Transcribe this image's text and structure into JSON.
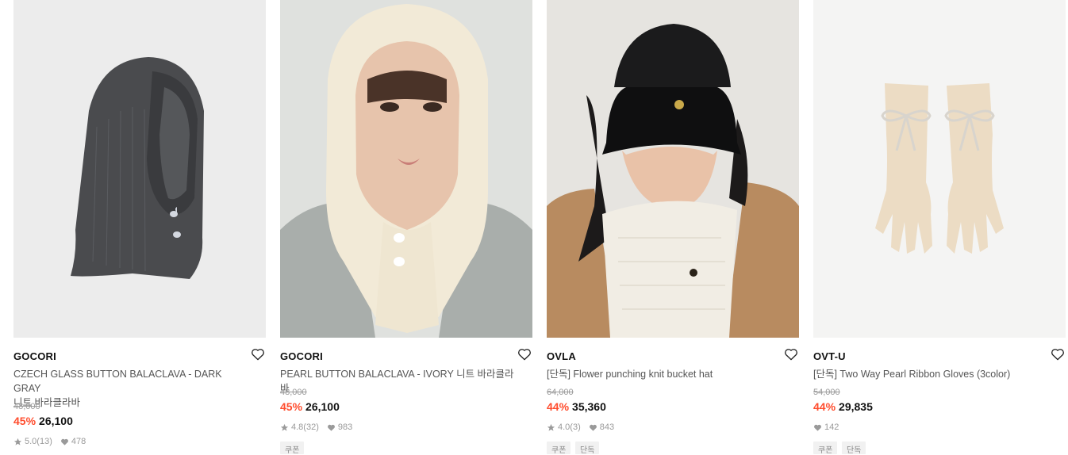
{
  "colors": {
    "discount": "#ff4d2e",
    "muted": "#9a9a9a",
    "badge_bg": "#f1f1f1"
  },
  "products": [
    {
      "brand": "GOCORI",
      "title_line1": "CZECH GLASS BUTTON BALACLAVA - DARK GRAY",
      "title_line2": "니트 바라클라바",
      "original_price": "48,000",
      "discount": "45%",
      "price": "26,100",
      "rating": "5.0",
      "reviews": "(13)",
      "likes": "478",
      "badges": [],
      "image_icon": "dark-gray-balaclava-photo",
      "bg_color": "#ececec"
    },
    {
      "brand": "GOCORI",
      "title_line1": "PEARL BUTTON BALACLAVA - IVORY 니트 바라클라바",
      "original_price": "48,000",
      "discount": "45%",
      "price": "26,100",
      "rating": "4.8",
      "reviews": "(32)",
      "likes": "983",
      "badges": [
        "쿠폰"
      ],
      "image_icon": "ivory-balaclava-model-photo",
      "bg_color": "#dfe1de"
    },
    {
      "brand": "OVLA",
      "title_line1": "[단독] Flower punching knit bucket hat",
      "original_price": "64,000",
      "discount": "44%",
      "price": "35,360",
      "rating": "4.0",
      "reviews": "(3)",
      "likes": "843",
      "badges": [
        "쿠폰",
        "단독"
      ],
      "image_icon": "black-bucket-hat-model-photo",
      "bg_color": "#e6e4e0"
    },
    {
      "brand": "OVT-U",
      "title_line1": "[단독] Two Way Pearl Ribbon Gloves (3color)",
      "original_price": "54,000",
      "discount": "44%",
      "price": "29,835",
      "likes": "142",
      "badges": [
        "쿠폰",
        "단독"
      ],
      "image_icon": "pearl-ribbon-gloves-photo",
      "bg_color": "#f4f4f3"
    }
  ]
}
